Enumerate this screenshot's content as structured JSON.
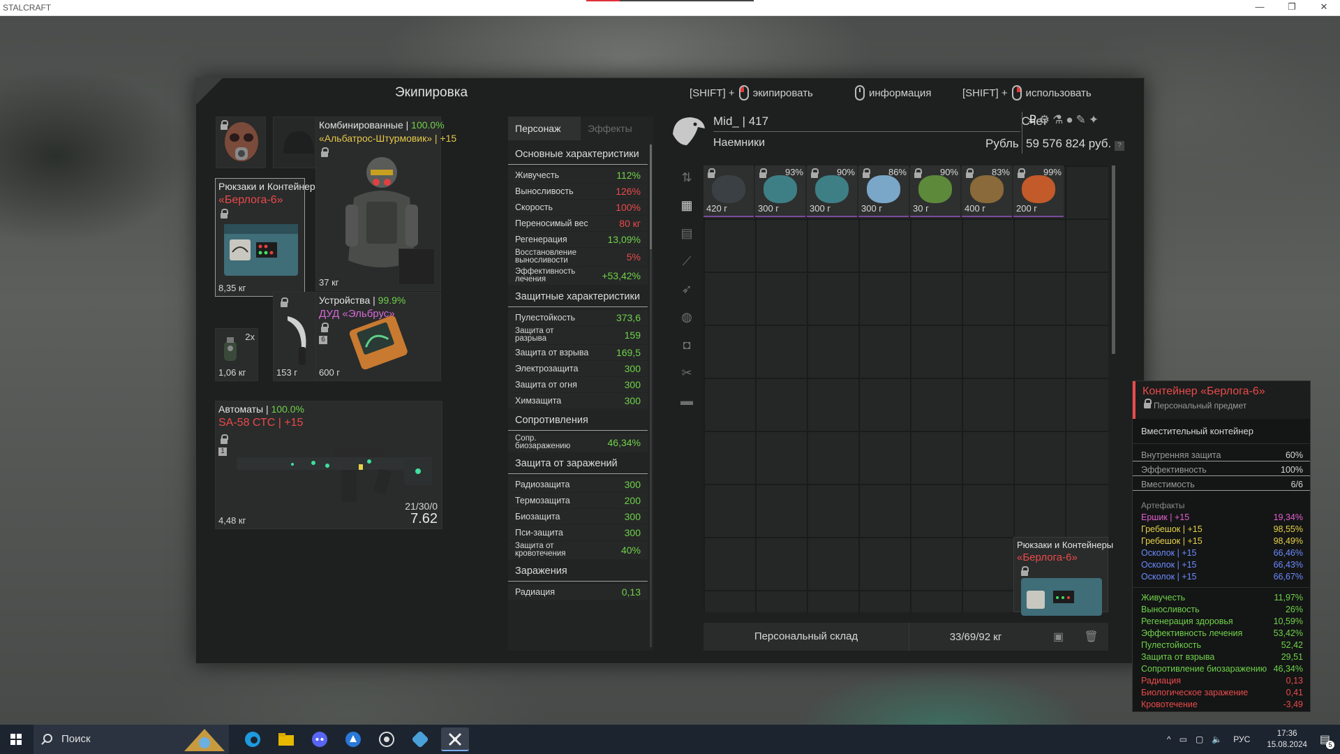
{
  "window": {
    "title": "STALCRAFT",
    "controls": [
      "—",
      "❐",
      "✕"
    ]
  },
  "panel": {
    "title": "Экипировка",
    "hints": [
      {
        "key": "[SHIFT] +",
        "action": "экипировать"
      },
      {
        "key": "",
        "action": "информация"
      },
      {
        "key": "[SHIFT] +",
        "action": "использовать"
      }
    ]
  },
  "equipment": {
    "armor": {
      "category": "Комбинированные | ",
      "durability": "100.0%",
      "name": "«Альбатрос-Штурмовик» | +15",
      "weight": "37 кг"
    },
    "container": {
      "category": "Рюкзаки и Контейнеры",
      "name": "«Берлога-6»",
      "weight": "8,35 кг"
    },
    "grenade": {
      "count": "2x",
      "weight": "1,06 кг"
    },
    "knife": {
      "weight": "153 г"
    },
    "device": {
      "category": "Устройства | ",
      "durability": "99.9%",
      "name": "ДУД «Эльбрус»",
      "slot": "6",
      "weight": "600 г"
    },
    "rifle": {
      "category": "Автоматы | ",
      "durability": "100.0%",
      "name": "SA-58 СТС | +15",
      "slot": "1",
      "weight": "4,48 кг",
      "ammo": "21/30/0",
      "caliber": "7.62"
    }
  },
  "stats": {
    "tabs": [
      "Персонаж",
      "Эффекты"
    ],
    "sections": [
      {
        "title": "Основные характеристики",
        "rows": [
          {
            "label": "Живучесть",
            "value": "112%",
            "color": "#6fd34a"
          },
          {
            "label": "Выносливость",
            "value": "126%",
            "color": "#ea4b4b"
          },
          {
            "label": "Скорость",
            "value": "100%",
            "color": "#ea4b4b"
          },
          {
            "label": "Переносимый вес",
            "value": "80 кг",
            "color": "#ea4b4b"
          },
          {
            "label": "Регенерация",
            "value": "13,09%",
            "color": "#6fd34a"
          },
          {
            "label": "Восстановление выносливости",
            "value": "5%",
            "color": "#ea4b4b"
          },
          {
            "label": "Эффективность лечения",
            "value": "+53,42%",
            "color": "#6fd34a"
          }
        ]
      },
      {
        "title": "Защитные характеристики",
        "rows": [
          {
            "label": "Пулестойкость",
            "value": "373,6",
            "color": "#6fd34a"
          },
          {
            "label": "Защита от разрыва",
            "value": "159",
            "color": "#6fd34a"
          },
          {
            "label": "Защита от взрыва",
            "value": "169,5",
            "color": "#6fd34a"
          },
          {
            "label": "Электрозащита",
            "value": "300",
            "color": "#6fd34a"
          },
          {
            "label": "Защита от огня",
            "value": "300",
            "color": "#6fd34a"
          },
          {
            "label": "Химзащита",
            "value": "300",
            "color": "#6fd34a"
          }
        ]
      },
      {
        "title": "Сопротивления",
        "rows": [
          {
            "label": "Сопр. биозаражению",
            "value": "46,34%",
            "color": "#6fd34a"
          }
        ]
      },
      {
        "title": "Защита от заражений",
        "rows": [
          {
            "label": "Радиозащита",
            "value": "300",
            "color": "#6fd34a"
          },
          {
            "label": "Термозащита",
            "value": "200",
            "color": "#6fd34a"
          },
          {
            "label": "Биозащита",
            "value": "300",
            "color": "#6fd34a"
          },
          {
            "label": "Пси-защита",
            "value": "300",
            "color": "#6fd34a"
          },
          {
            "label": "Защита от кровотечения",
            "value": "40%",
            "color": "#6fd34a"
          }
        ]
      },
      {
        "title": "Заражения",
        "rows": [
          {
            "label": "Радиация",
            "value": "0,13",
            "color": "#6fd34a"
          }
        ]
      }
    ]
  },
  "player": {
    "name": "Mid_ | 417",
    "faction": "Наемники",
    "account_label": "Счет",
    "currency_label": "Рубль",
    "balance": "59 576 824 руб.",
    "help": "?"
  },
  "inventory": {
    "items": [
      {
        "pct": "",
        "weight": "420 г",
        "color": "#3a4044"
      },
      {
        "pct": "93%",
        "weight": "300 г",
        "color": "#3e7f86"
      },
      {
        "pct": "90%",
        "weight": "300 г",
        "color": "#3e7f86"
      },
      {
        "pct": "86%",
        "weight": "300 г",
        "color": "#7aa6c8"
      },
      {
        "pct": "90%",
        "weight": "30 г",
        "color": "#5d8a3a"
      },
      {
        "pct": "83%",
        "weight": "400 г",
        "color": "#8a6a3a"
      },
      {
        "pct": "99%",
        "weight": "200 г",
        "color": "#c25a2a"
      }
    ],
    "bottom_container": {
      "category": "Рюкзаки и Контейнеры",
      "name": "«Берлога-6»"
    },
    "storage_label": "Персональный склад",
    "storage_weight": "33/69/92 кг"
  },
  "tooltip": {
    "title": "Контейнер «Берлога-6»",
    "subtitle": "Персональный предмет",
    "type": "Вместительный контейнер",
    "props": [
      {
        "label": "Внутренняя защита",
        "value": "60%"
      },
      {
        "label": "Эффективность",
        "value": "100%"
      },
      {
        "label": "Вместимость",
        "value": "6/6"
      }
    ],
    "artifacts_title": "Артефакты",
    "artifacts": [
      {
        "label": "Ершик | +15",
        "value": "19,34%",
        "color": "#e060d0"
      },
      {
        "label": "Гребешок | +15",
        "value": "98,55%",
        "color": "#e6d34a"
      },
      {
        "label": "Гребешок | +15",
        "value": "98,49%",
        "color": "#e6d34a"
      },
      {
        "label": "Осколок | +15",
        "value": "66,46%",
        "color": "#6b8cff"
      },
      {
        "label": "Осколок | +15",
        "value": "66,43%",
        "color": "#6b8cff"
      },
      {
        "label": "Осколок | +15",
        "value": "66,67%",
        "color": "#6b8cff"
      }
    ],
    "effects": [
      {
        "label": "Живучесть",
        "value": "11,97%",
        "color": "#6fd34a"
      },
      {
        "label": "Выносливость",
        "value": "26%",
        "color": "#6fd34a"
      },
      {
        "label": "Регенерация здоровья",
        "value": "10,59%",
        "color": "#6fd34a"
      },
      {
        "label": "Эффективность лечения",
        "value": "53,42%",
        "color": "#6fd34a"
      },
      {
        "label": "Пулестойкость",
        "value": "52,42",
        "color": "#6fd34a"
      },
      {
        "label": "Защита от взрыва",
        "value": "29,51",
        "color": "#6fd34a"
      },
      {
        "label": "Сопротивление биозаражению",
        "value": "46,34%",
        "color": "#6fd34a"
      },
      {
        "label": "Радиация",
        "value": "0,13",
        "color": "#ea4b4b"
      },
      {
        "label": "Биологическое заражение",
        "value": "0,41",
        "color": "#ea4b4b"
      },
      {
        "label": "Кровотечение",
        "value": "-3,49",
        "color": "#ea4b4b"
      }
    ]
  },
  "taskbar": {
    "search_placeholder": "Поиск",
    "lang": "РУС",
    "time": "17:36",
    "date": "15.08.2024",
    "notifications": "5",
    "tray_up": "^"
  }
}
